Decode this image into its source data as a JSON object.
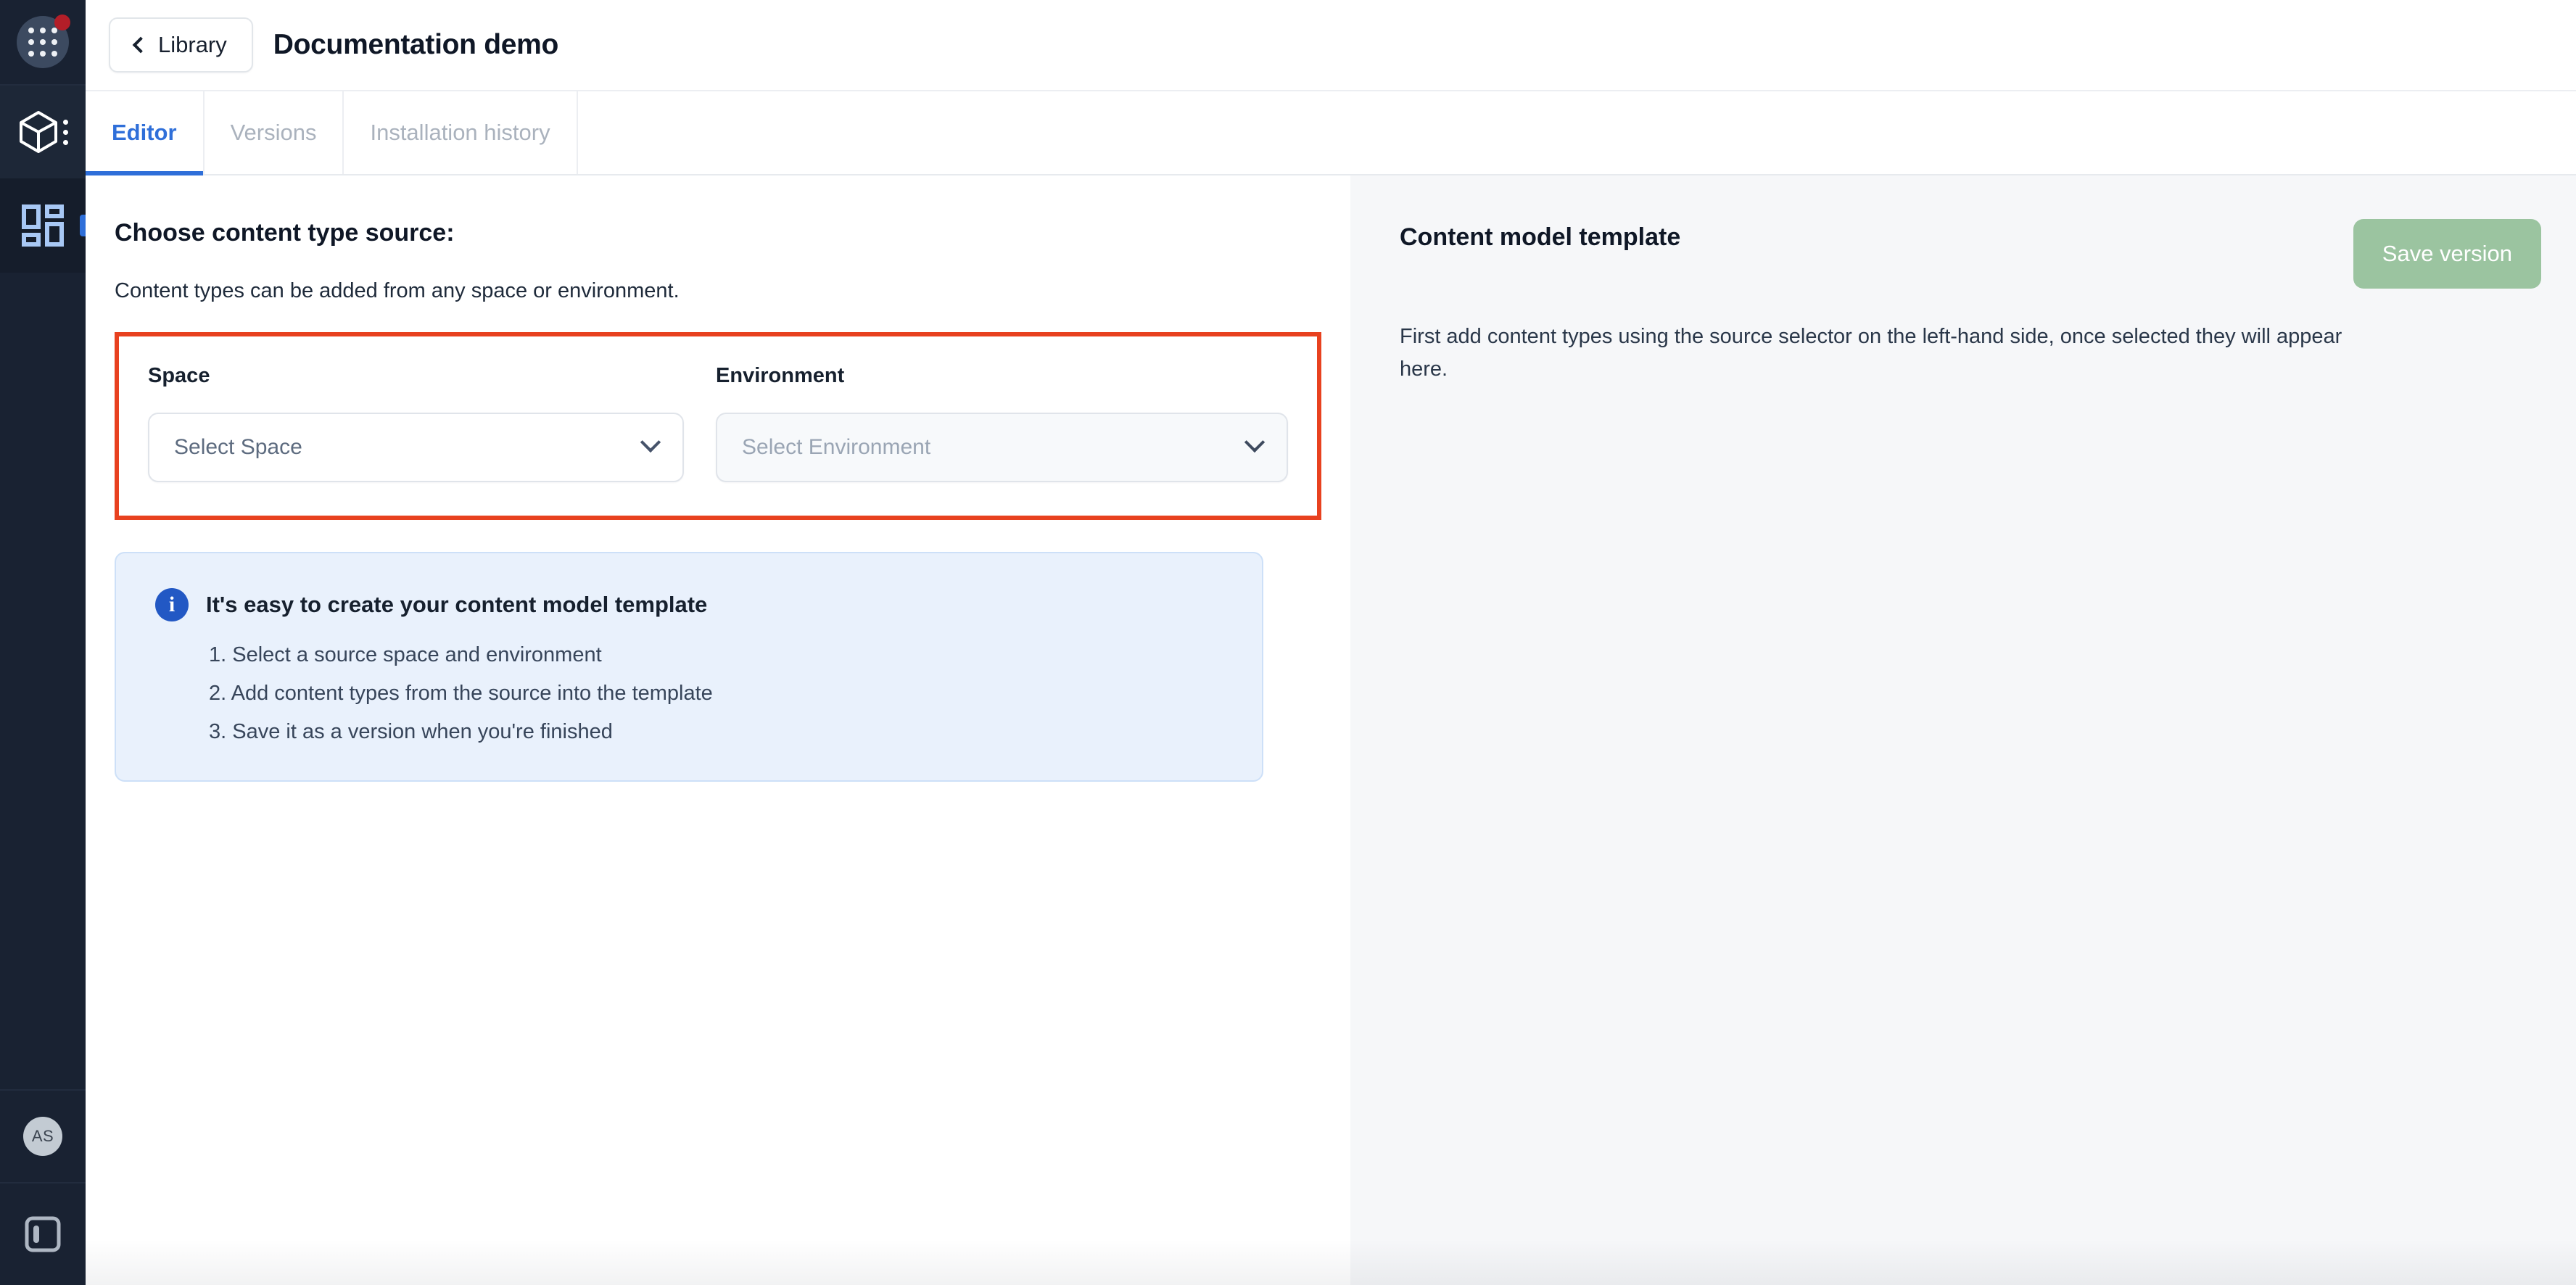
{
  "rail": {
    "waffle_icon": "apps-grid-icon",
    "notification_badge": "",
    "product_icon": "cube-icon",
    "kebab_icon": "kebab-menu-icon",
    "apps_icon": "apps-blocks-icon",
    "avatar_initials": "AS",
    "panel_icon": "toggle-sidepanel-icon"
  },
  "topbar": {
    "back_label": "Library",
    "title": "Documentation demo"
  },
  "tabs": [
    {
      "label": "Editor",
      "active": true
    },
    {
      "label": "Versions",
      "active": false
    },
    {
      "label": "Installation history",
      "active": false
    }
  ],
  "left": {
    "section_title": "Choose content type source:",
    "section_subtitle": "Content types can be added from any space or environment.",
    "space": {
      "label": "Space",
      "placeholder": "Select Space",
      "value": "Select Space"
    },
    "environment": {
      "label": "Environment",
      "placeholder": "Select Environment",
      "value": "Select Environment"
    },
    "callout": {
      "title": "It's easy to create your content model template",
      "steps": [
        "1. Select a source space and environment",
        "2. Add content types from the source into the template",
        "3. Save it as a version when you're finished"
      ]
    }
  },
  "right": {
    "title": "Content model template",
    "save_label": "Save version",
    "description": "First add content types using the source selector on the left-hand side, once selected they will appear here."
  },
  "colors": {
    "accent_blue": "#2f6fd9",
    "highlight_red": "#e8411f",
    "save_green": "#9bc4a0",
    "rail_dark": "#192232",
    "callout_blue": "#e9f1fc",
    "info_icon_blue": "#2258c4",
    "right_pane_bg": "#f6f7f9"
  }
}
